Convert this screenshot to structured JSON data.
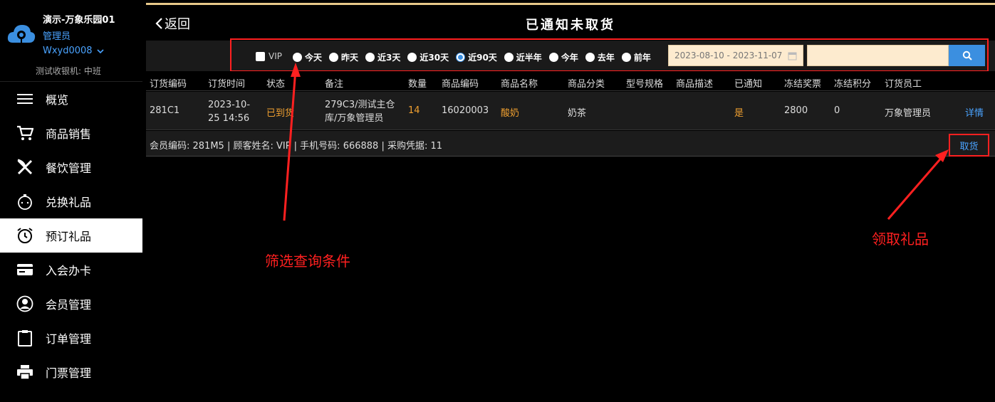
{
  "sidebar": {
    "store_name": "演示-万象乐园01",
    "role": "管理员",
    "username": "Wxyd0008",
    "cashier": "测试收银机: 中班",
    "items": [
      {
        "label": "概览",
        "icon": "menu-icon"
      },
      {
        "label": "商品销售",
        "icon": "cart-icon"
      },
      {
        "label": "餐饮管理",
        "icon": "cutlery-icon"
      },
      {
        "label": "兑换礼品",
        "icon": "gift-exchange-icon"
      },
      {
        "label": "预订礼品",
        "icon": "alarm-clock-icon"
      },
      {
        "label": "入会办卡",
        "icon": "card-icon"
      },
      {
        "label": "会员管理",
        "icon": "user-circle-icon"
      },
      {
        "label": "订单管理",
        "icon": "clipboard-icon"
      },
      {
        "label": "门票管理",
        "icon": "printer-icon"
      }
    ]
  },
  "header": {
    "back_label": "返回",
    "title": "已通知未取货"
  },
  "filters": {
    "vip_label": "VIP",
    "ranges": [
      "今天",
      "昨天",
      "近3天",
      "近30天",
      "近90天",
      "近半年",
      "今年",
      "去年",
      "前年"
    ],
    "selected_range": "近90天",
    "date_range": "2023-08-10 - 2023-11-07"
  },
  "table": {
    "columns": [
      "订货编码",
      "订货时间",
      "状态",
      "备注",
      "数量",
      "商品编码",
      "商品名称",
      "商品分类",
      "型号规格",
      "商品描述",
      "已通知",
      "冻结奖票",
      "冻结积分",
      "订货员工"
    ],
    "row": {
      "order_code": "281C1",
      "order_time_line1": "2023-10-",
      "order_time_line2": "25 14:56",
      "status": "已到货",
      "remark_line1": "279C3/测试主仓",
      "remark_line2": "库/万象管理员",
      "quantity": "14",
      "product_code": "16020003",
      "product_name": "酸奶",
      "category": "奶茶",
      "spec": "",
      "description": "",
      "notified": "是",
      "frozen_tickets": "2800",
      "frozen_points": "0",
      "staff": "万象管理员",
      "details_label": "详情"
    },
    "subrow_info": "会员编码: 281M5 | 顾客姓名: VIP | 手机号码: 666888  | 采购凭据: 11",
    "pickup_label": "取货"
  },
  "annotations": {
    "filter_note": "筛选查询条件",
    "pickup_note": "领取礼品"
  },
  "colors": {
    "accent": "#3b8fe0",
    "highlight": "#ff2020",
    "orange": "#f0a030",
    "input_bg": "#fdebcf"
  }
}
